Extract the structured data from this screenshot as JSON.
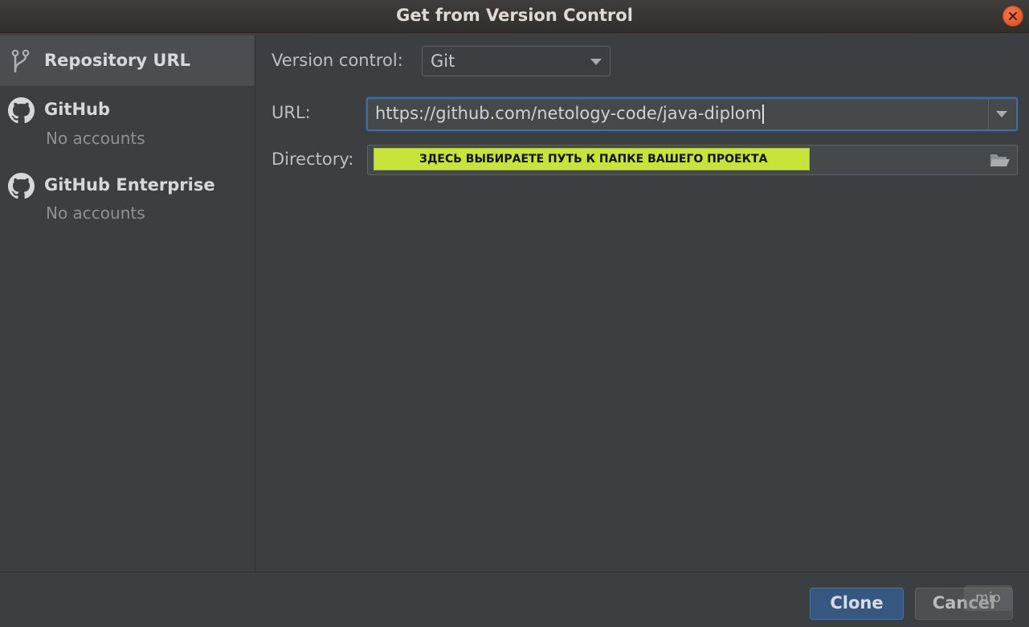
{
  "window": {
    "title": "Get from Version Control"
  },
  "sidebar": {
    "items": [
      {
        "label": "Repository URL",
        "icon": "vcs-branch-icon",
        "selected": true
      },
      {
        "label": "GitHub",
        "sublabel": "No accounts",
        "icon": "github-icon"
      },
      {
        "label": "GitHub Enterprise",
        "sublabel": "No accounts",
        "icon": "github-icon"
      }
    ]
  },
  "form": {
    "version_control_label": "Version control:",
    "version_control_value": "Git",
    "url_label": "URL:",
    "url_value": "https://github.com/netology-code/java-diplom",
    "directory_label": "Directory:",
    "directory_annotation": "ЗДЕСЬ ВЫБИРАЕТЕ ПУТЬ К ПАПКЕ ВАШЕГО ПРОЕКТА"
  },
  "buttons": {
    "clone": "Clone",
    "cancel": "Cancel"
  },
  "watermark": "mio",
  "colors": {
    "background": "#3c3f41",
    "selected_item": "#4b4e51",
    "focus_border": "#3a6ea5",
    "primary_button": "#365880",
    "annotation_highlight": "#c8e33a",
    "close_button": "#e65a2a"
  }
}
